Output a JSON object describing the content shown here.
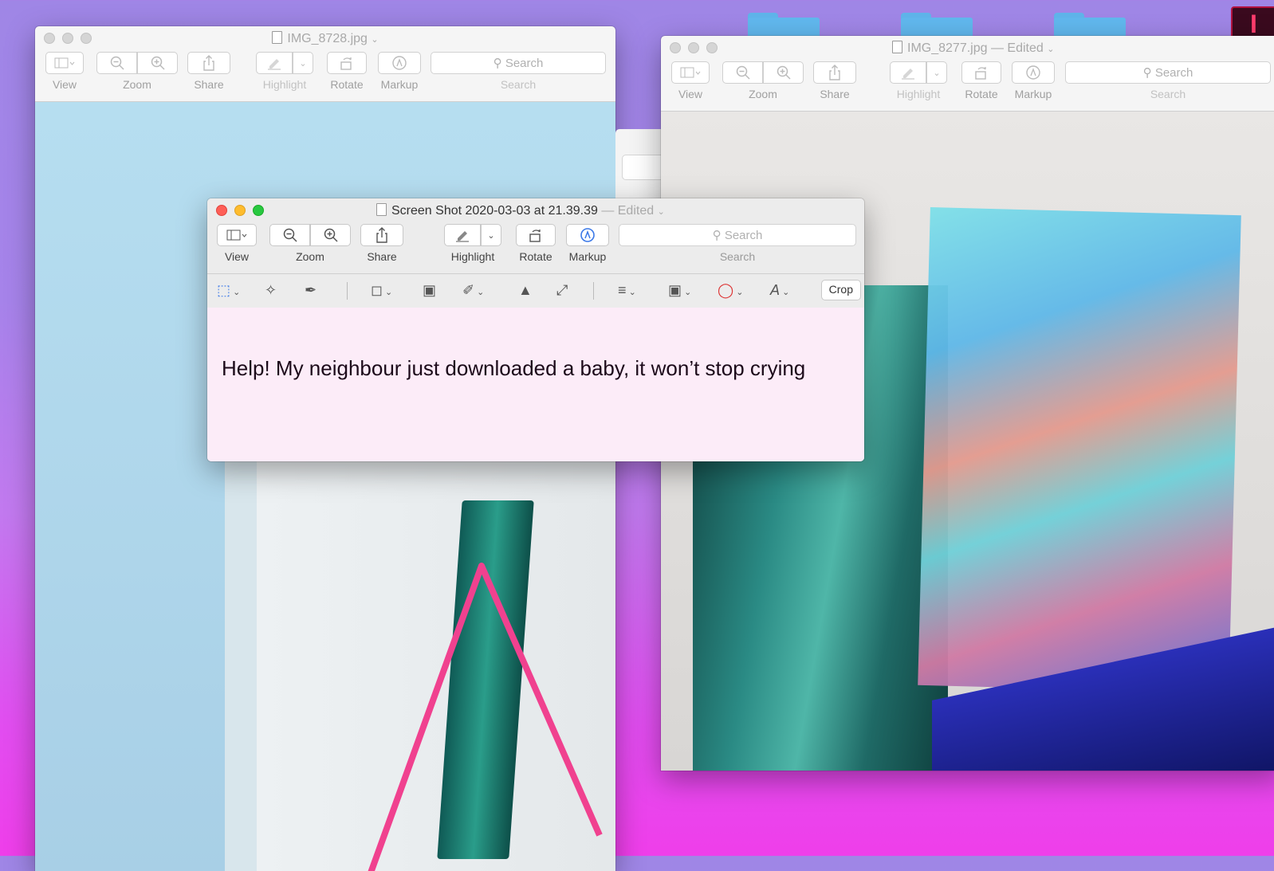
{
  "windows": {
    "left": {
      "title": "IMG_8728.jpg",
      "toolbar": {
        "view": "View",
        "zoom": "Zoom",
        "share": "Share",
        "highlight": "Highlight",
        "rotate": "Rotate",
        "markup": "Markup",
        "search_placeholder": "Search",
        "search_label": "Search"
      }
    },
    "right": {
      "title": "IMG_8277.jpg",
      "edited": "— Edited",
      "toolbar": {
        "view": "View",
        "zoom": "Zoom",
        "share": "Share",
        "highlight": "Highlight",
        "rotate": "Rotate",
        "markup": "Markup",
        "search_placeholder": "Search",
        "search_label": "Search"
      }
    },
    "front": {
      "title": "Screen Shot 2020-03-03 at 21.39.39",
      "edited": "— Edited",
      "toolbar": {
        "view": "View",
        "zoom": "Zoom",
        "share": "Share",
        "highlight": "Highlight",
        "rotate": "Rotate",
        "markup": "Markup",
        "search_placeholder": "Search",
        "search_label": "Search"
      },
      "markup_bar": {
        "crop": "Crop"
      },
      "document_text": "Help! My neighbour just downloaded a baby, it won’t stop crying"
    }
  },
  "colors": {
    "desktop_top": "#9f86e6",
    "desktop_bottom": "#ef3eea",
    "folder": "#61b8ee",
    "markup_accent": "#3a78e7"
  },
  "icons": [
    "sidebar-icon",
    "zoom-out-icon",
    "zoom-in-icon",
    "share-icon",
    "highlight-pen-icon",
    "rotate-icon",
    "markup-pen-icon",
    "search-icon",
    "selection-icon",
    "instant-alpha-icon",
    "sketch-icon",
    "shapes-icon",
    "text-box-icon",
    "signature-icon",
    "adjust-color-icon",
    "adjust-size-icon",
    "shape-style-icon",
    "border-color-icon",
    "fill-color-icon",
    "text-style-icon",
    "folder-icon"
  ]
}
